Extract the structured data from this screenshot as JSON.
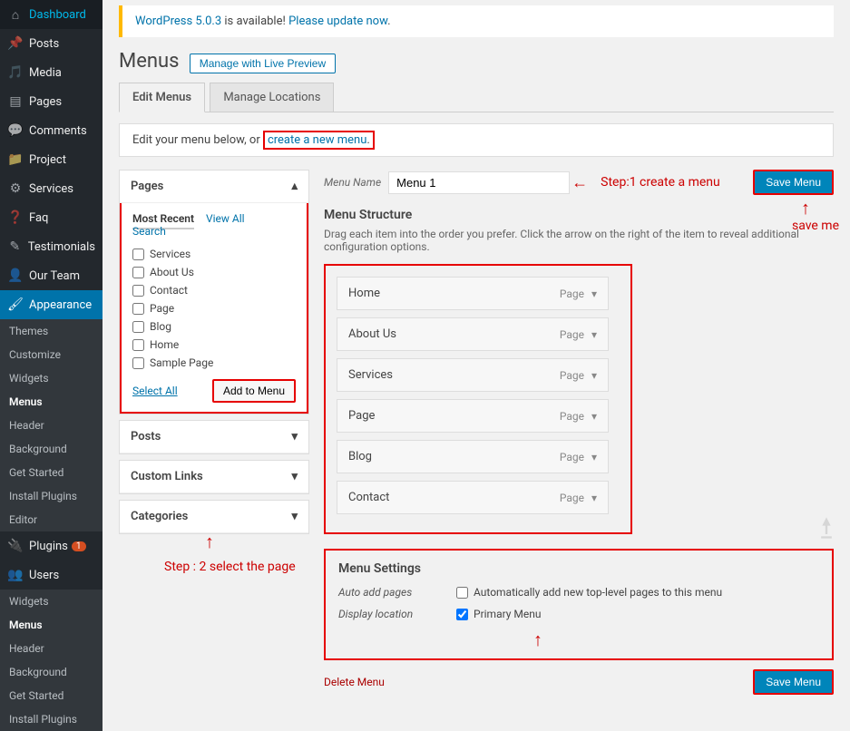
{
  "sidebar": {
    "items": [
      {
        "label": "Dashboard",
        "icon": "⌂"
      },
      {
        "label": "Posts",
        "icon": "✎"
      },
      {
        "label": "Media",
        "icon": "📷"
      },
      {
        "label": "Pages",
        "icon": "▤"
      },
      {
        "label": "Comments",
        "icon": "💬"
      },
      {
        "label": "Project",
        "icon": "📁"
      },
      {
        "label": "Services",
        "icon": "⚙"
      },
      {
        "label": "Faq",
        "icon": "❓"
      },
      {
        "label": "Testimonials",
        "icon": "✎"
      },
      {
        "label": "Our Team",
        "icon": "👤"
      },
      {
        "label": "Appearance",
        "icon": "🖌"
      },
      {
        "label": "Plugins",
        "icon": "🔌",
        "badge": "1"
      },
      {
        "label": "Users",
        "icon": "👥"
      }
    ],
    "appearance_sub": [
      "Themes",
      "Customize",
      "Widgets",
      "Menus",
      "Header",
      "Background",
      "Get Started",
      "Install Plugins",
      "Editor"
    ],
    "bottom_sub": [
      "Widgets",
      "Menus",
      "Header",
      "Background",
      "Get Started",
      "Install Plugins"
    ]
  },
  "notice": {
    "version_link": "WordPress 5.0.3",
    "text": " is available! ",
    "update_link": "Please update now"
  },
  "page_title": "Menus",
  "live_preview_btn": "Manage with Live Preview",
  "tabs": [
    "Edit Menus",
    "Manage Locations"
  ],
  "instruction": {
    "prefix": "Edit your menu below, or ",
    "link": "create a new menu"
  },
  "accordion": {
    "pages": {
      "title": "Pages",
      "tabs": [
        "Most Recent",
        "View All",
        "Search"
      ],
      "items": [
        "Services",
        "About Us",
        "Contact",
        "Page",
        "Blog",
        "Home",
        "Sample Page"
      ],
      "select_all": "Select All",
      "add_btn": "Add to Menu"
    },
    "posts": "Posts",
    "custom": "Custom Links",
    "categories": "Categories"
  },
  "menu_name": {
    "label": "Menu Name",
    "value": "Menu 1"
  },
  "save_btn": "Save Menu",
  "structure": {
    "heading": "Menu Structure",
    "help": "Drag each item into the order you prefer. Click the arrow on the right of the item to reveal additional configuration options.",
    "items": [
      {
        "title": "Home",
        "type": "Page"
      },
      {
        "title": "About Us",
        "type": "Page"
      },
      {
        "title": "Services",
        "type": "Page"
      },
      {
        "title": "Page",
        "type": "Page"
      },
      {
        "title": "Blog",
        "type": "Page"
      },
      {
        "title": "Contact",
        "type": "Page"
      }
    ]
  },
  "settings": {
    "heading": "Menu Settings",
    "auto_label": "Auto add pages",
    "auto_text": "Automatically add new top-level pages to this menu",
    "display_label": "Display location",
    "display_text": "Primary Menu"
  },
  "delete_link": "Delete Menu",
  "annotations": {
    "step1": "Step:1 create a menu",
    "save_me": "save me",
    "step2": "Step : 2 select the page"
  }
}
